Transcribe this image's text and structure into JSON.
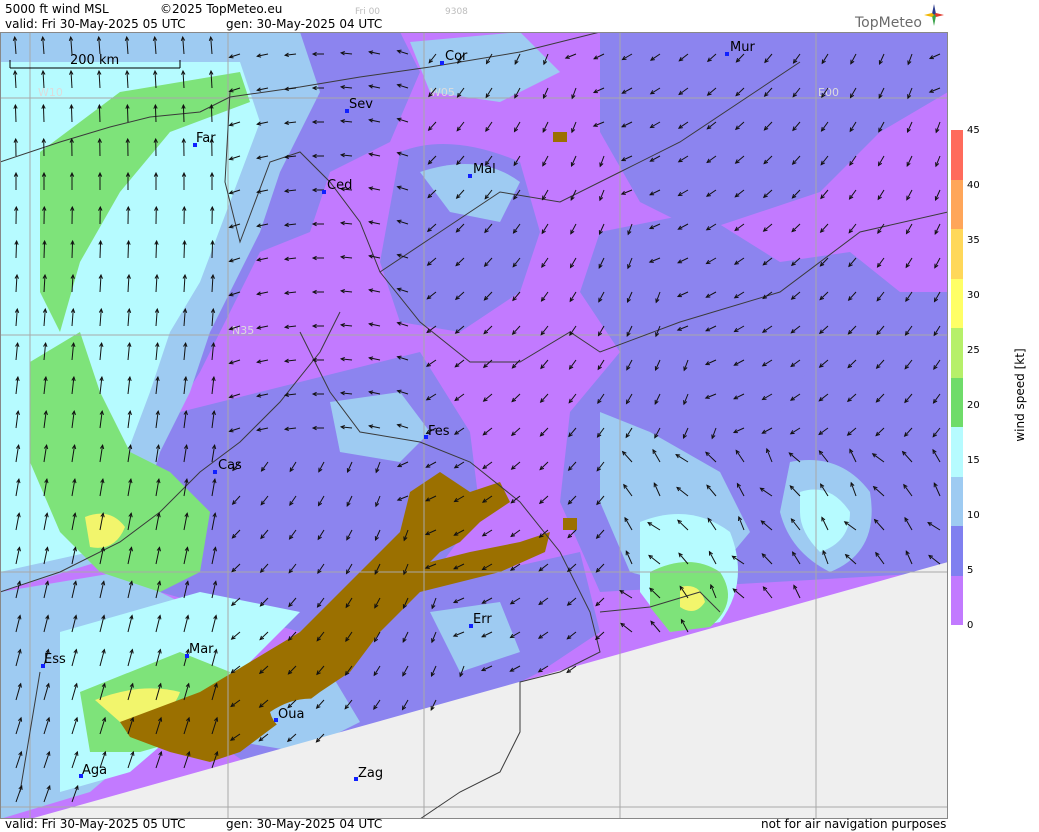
{
  "header": {
    "product": "5000 ft wind MSL",
    "copyright": "©2025 TopMeteo.eu",
    "small_day": "Fri 00",
    "small_code": "9308",
    "valid": "valid:  Fri  30-May-2025  05 UTC",
    "generated": "gen: 30-May-2025 04 UTC",
    "logo": "TopMeteo"
  },
  "footer": {
    "valid": "valid:  Fri  30-May-2025  05 UTC",
    "generated": "gen: 30-May-2025 04 UTC",
    "disclaimer": "not for air navigation purposes"
  },
  "map": {
    "scale_label": "200 km",
    "grid_labels": [
      "W10",
      "W05",
      "E00",
      "N35"
    ],
    "cities": [
      {
        "name": "Cor"
      },
      {
        "name": "Mur"
      },
      {
        "name": "Sev"
      },
      {
        "name": "Far"
      },
      {
        "name": "Mal"
      },
      {
        "name": "Ced"
      },
      {
        "name": "Fes"
      },
      {
        "name": "Cas"
      },
      {
        "name": "Err"
      },
      {
        "name": "Mar"
      },
      {
        "name": "Ess"
      },
      {
        "name": "Oua"
      },
      {
        "name": "Aga"
      },
      {
        "name": "Zag"
      }
    ]
  },
  "legend": {
    "title": "wind speed [kt]",
    "ticks": [
      "45",
      "40",
      "35",
      "30",
      "25",
      "20",
      "15",
      "10",
      "5",
      "0"
    ],
    "colors": [
      "#ff6b5c",
      "#ffa65a",
      "#ffd85a",
      "#ffff66",
      "#b6f06a",
      "#6fdc6a",
      "#b6fbff",
      "#9ecbf2",
      "#8080f0",
      "#c27aff"
    ]
  },
  "colors": {
    "low_wind_violet": "#c27aff",
    "blue_5kt": "#8c84ef",
    "lightblue_10kt": "#9ecbf2",
    "cyan_15kt": "#b6fbff",
    "green_20kt": "#7ee37a",
    "yellow_30kt": "#f2f56c",
    "terrain_brown": "#9b7000",
    "no_data_gray": "#efefef"
  }
}
